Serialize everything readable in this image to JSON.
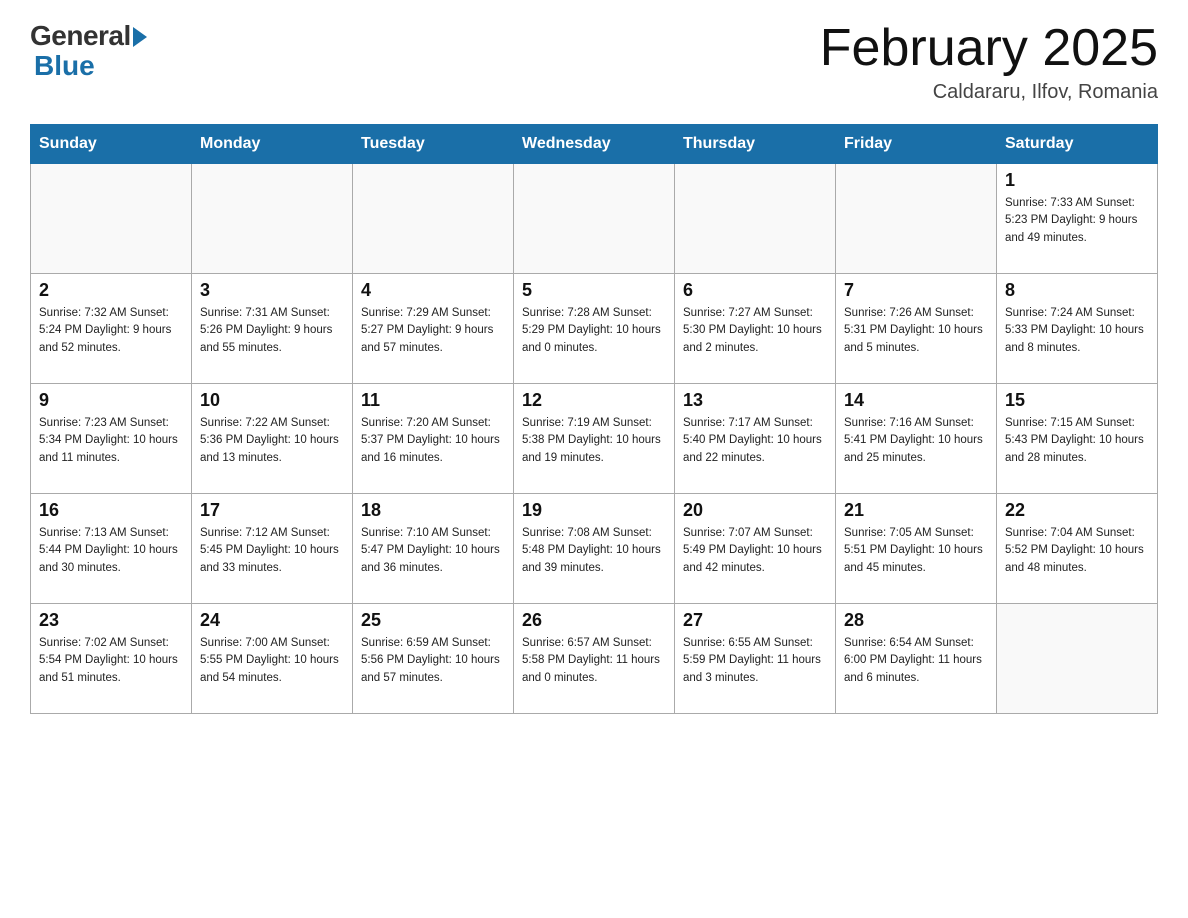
{
  "header": {
    "logo_general": "General",
    "logo_blue": "Blue",
    "title": "February 2025",
    "location": "Caldararu, Ilfov, Romania"
  },
  "weekdays": [
    "Sunday",
    "Monday",
    "Tuesday",
    "Wednesday",
    "Thursday",
    "Friday",
    "Saturday"
  ],
  "weeks": [
    [
      {
        "day": "",
        "info": ""
      },
      {
        "day": "",
        "info": ""
      },
      {
        "day": "",
        "info": ""
      },
      {
        "day": "",
        "info": ""
      },
      {
        "day": "",
        "info": ""
      },
      {
        "day": "",
        "info": ""
      },
      {
        "day": "1",
        "info": "Sunrise: 7:33 AM\nSunset: 5:23 PM\nDaylight: 9 hours and 49 minutes."
      }
    ],
    [
      {
        "day": "2",
        "info": "Sunrise: 7:32 AM\nSunset: 5:24 PM\nDaylight: 9 hours and 52 minutes."
      },
      {
        "day": "3",
        "info": "Sunrise: 7:31 AM\nSunset: 5:26 PM\nDaylight: 9 hours and 55 minutes."
      },
      {
        "day": "4",
        "info": "Sunrise: 7:29 AM\nSunset: 5:27 PM\nDaylight: 9 hours and 57 minutes."
      },
      {
        "day": "5",
        "info": "Sunrise: 7:28 AM\nSunset: 5:29 PM\nDaylight: 10 hours and 0 minutes."
      },
      {
        "day": "6",
        "info": "Sunrise: 7:27 AM\nSunset: 5:30 PM\nDaylight: 10 hours and 2 minutes."
      },
      {
        "day": "7",
        "info": "Sunrise: 7:26 AM\nSunset: 5:31 PM\nDaylight: 10 hours and 5 minutes."
      },
      {
        "day": "8",
        "info": "Sunrise: 7:24 AM\nSunset: 5:33 PM\nDaylight: 10 hours and 8 minutes."
      }
    ],
    [
      {
        "day": "9",
        "info": "Sunrise: 7:23 AM\nSunset: 5:34 PM\nDaylight: 10 hours and 11 minutes."
      },
      {
        "day": "10",
        "info": "Sunrise: 7:22 AM\nSunset: 5:36 PM\nDaylight: 10 hours and 13 minutes."
      },
      {
        "day": "11",
        "info": "Sunrise: 7:20 AM\nSunset: 5:37 PM\nDaylight: 10 hours and 16 minutes."
      },
      {
        "day": "12",
        "info": "Sunrise: 7:19 AM\nSunset: 5:38 PM\nDaylight: 10 hours and 19 minutes."
      },
      {
        "day": "13",
        "info": "Sunrise: 7:17 AM\nSunset: 5:40 PM\nDaylight: 10 hours and 22 minutes."
      },
      {
        "day": "14",
        "info": "Sunrise: 7:16 AM\nSunset: 5:41 PM\nDaylight: 10 hours and 25 minutes."
      },
      {
        "day": "15",
        "info": "Sunrise: 7:15 AM\nSunset: 5:43 PM\nDaylight: 10 hours and 28 minutes."
      }
    ],
    [
      {
        "day": "16",
        "info": "Sunrise: 7:13 AM\nSunset: 5:44 PM\nDaylight: 10 hours and 30 minutes."
      },
      {
        "day": "17",
        "info": "Sunrise: 7:12 AM\nSunset: 5:45 PM\nDaylight: 10 hours and 33 minutes."
      },
      {
        "day": "18",
        "info": "Sunrise: 7:10 AM\nSunset: 5:47 PM\nDaylight: 10 hours and 36 minutes."
      },
      {
        "day": "19",
        "info": "Sunrise: 7:08 AM\nSunset: 5:48 PM\nDaylight: 10 hours and 39 minutes."
      },
      {
        "day": "20",
        "info": "Sunrise: 7:07 AM\nSunset: 5:49 PM\nDaylight: 10 hours and 42 minutes."
      },
      {
        "day": "21",
        "info": "Sunrise: 7:05 AM\nSunset: 5:51 PM\nDaylight: 10 hours and 45 minutes."
      },
      {
        "day": "22",
        "info": "Sunrise: 7:04 AM\nSunset: 5:52 PM\nDaylight: 10 hours and 48 minutes."
      }
    ],
    [
      {
        "day": "23",
        "info": "Sunrise: 7:02 AM\nSunset: 5:54 PM\nDaylight: 10 hours and 51 minutes."
      },
      {
        "day": "24",
        "info": "Sunrise: 7:00 AM\nSunset: 5:55 PM\nDaylight: 10 hours and 54 minutes."
      },
      {
        "day": "25",
        "info": "Sunrise: 6:59 AM\nSunset: 5:56 PM\nDaylight: 10 hours and 57 minutes."
      },
      {
        "day": "26",
        "info": "Sunrise: 6:57 AM\nSunset: 5:58 PM\nDaylight: 11 hours and 0 minutes."
      },
      {
        "day": "27",
        "info": "Sunrise: 6:55 AM\nSunset: 5:59 PM\nDaylight: 11 hours and 3 minutes."
      },
      {
        "day": "28",
        "info": "Sunrise: 6:54 AM\nSunset: 6:00 PM\nDaylight: 11 hours and 6 minutes."
      },
      {
        "day": "",
        "info": ""
      }
    ]
  ]
}
